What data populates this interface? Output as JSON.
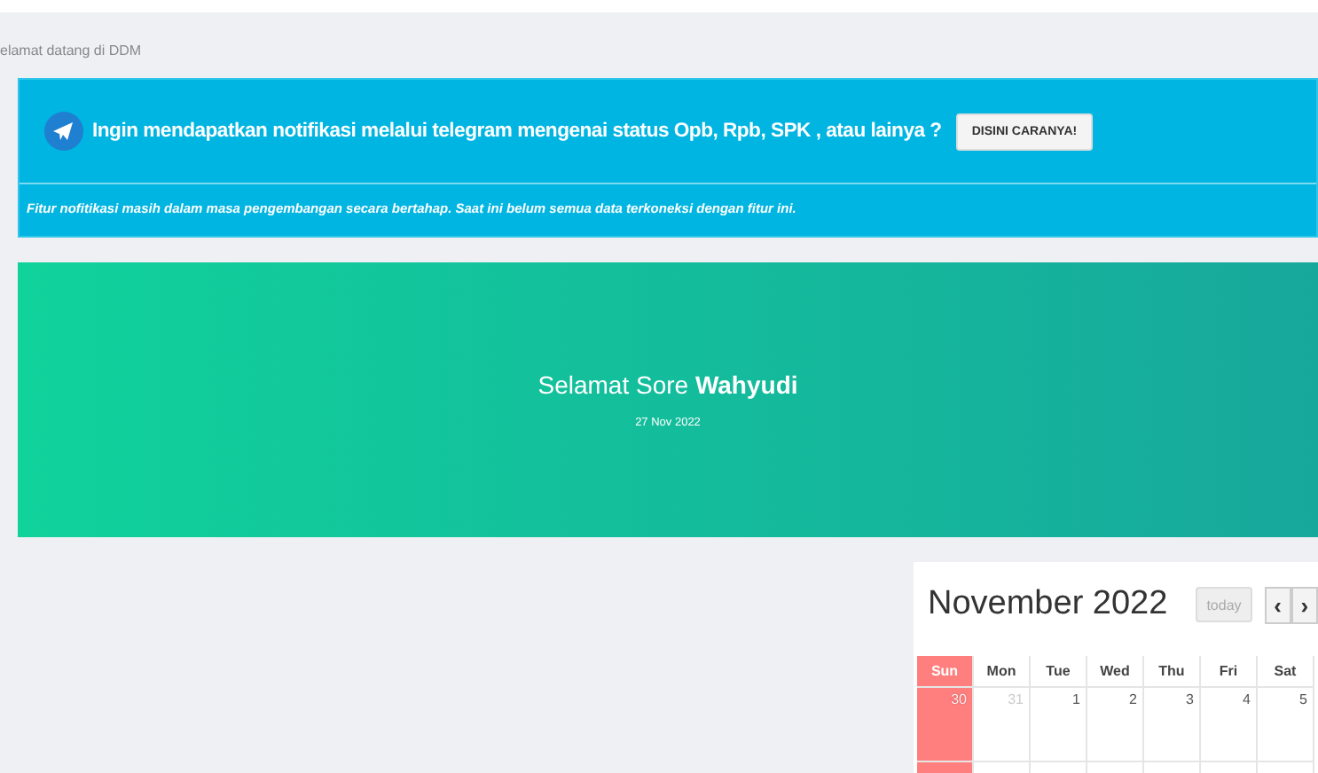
{
  "welcome": "elamat datang di DDM",
  "notice": {
    "headline": "Ingin mendapatkan notifikasi melalui telegram mengenai status Opb, Rpb, SPK , atau lainya ?",
    "button": "DISINI CARANYA!",
    "footnote": "Fitur nofitikasi masih dalam masa pengembangan secara bertahap. Saat ini belum semua data terkoneksi dengan fitur ini."
  },
  "greeting": {
    "text": "Selamat Sore **Wahyudi**",
    "date": "27 Nov 2022"
  },
  "calendar": {
    "title": "November 2022",
    "today_button": "today",
    "prev_button": "‹",
    "next_button": "›",
    "weekdays": [
      {
        "label": "Sun",
        "highlighted": true
      },
      {
        "label": "Mon",
        "highlighted": false
      },
      {
        "label": "Tue",
        "highlighted": false
      },
      {
        "label": "Wed",
        "highlighted": false
      },
      {
        "label": "Thu",
        "highlighted": false
      },
      {
        "label": "Fri",
        "highlighted": false
      },
      {
        "label": "Sat",
        "highlighted": false
      }
    ],
    "weeks": [
      [
        {
          "day": "30",
          "other_month": true
        },
        {
          "day": "31",
          "other_month": true
        },
        {
          "day": "1",
          "other_month": false
        },
        {
          "day": "2",
          "other_month": false
        },
        {
          "day": "3",
          "other_month": false
        },
        {
          "day": "4",
          "other_month": false
        },
        {
          "day": "5",
          "other_month": false
        }
      ]
    ]
  }
}
